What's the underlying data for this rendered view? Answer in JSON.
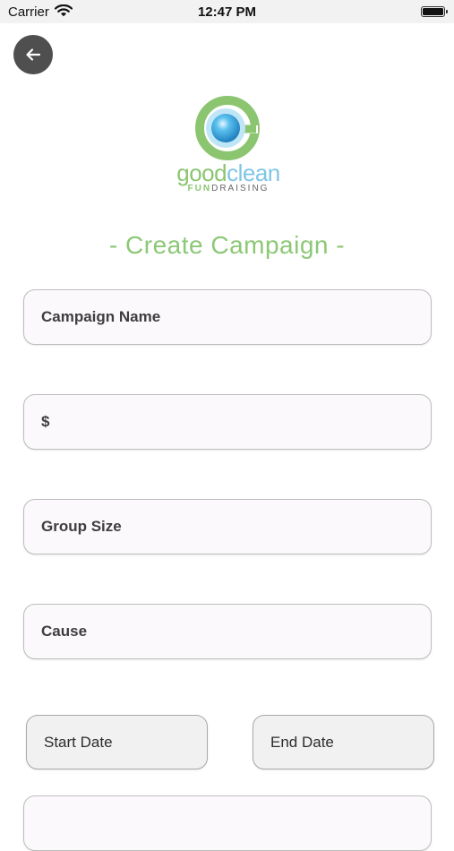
{
  "status_bar": {
    "carrier": "Carrier",
    "time": "12:47 PM"
  },
  "logo": {
    "word_a": "good",
    "word_b": "clean",
    "sub_a": "FUN",
    "sub_b": "DRAISING"
  },
  "title": "- Create Campaign -",
  "fields": [
    {
      "label": "Campaign Name"
    },
    {
      "label": "$"
    },
    {
      "label": "Group Size"
    },
    {
      "label": "Cause"
    }
  ],
  "dates": {
    "start": "Start Date",
    "end": "End Date"
  },
  "colors": {
    "brand_green": "#8cc876",
    "brand_blue": "#7fc6e6",
    "back_button": "#4f4f4f"
  }
}
